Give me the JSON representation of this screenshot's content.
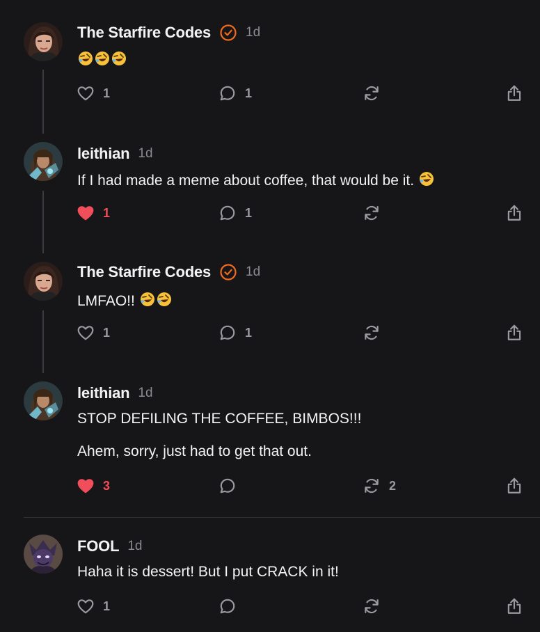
{
  "posts": [
    {
      "author": "The Starfire Codes",
      "verified": true,
      "time": "1d",
      "lines": [
        ""
      ],
      "emoji_count": 3,
      "likes": "1",
      "liked": false,
      "replies": "1",
      "reposts": "",
      "avatar": "starfire"
    },
    {
      "author": "leithian",
      "verified": false,
      "time": "1d",
      "lines": [
        "If I had made a meme about coffee, that would be it."
      ],
      "emoji_count": 1,
      "likes": "1",
      "liked": true,
      "replies": "1",
      "reposts": "",
      "avatar": "leithian"
    },
    {
      "author": "The Starfire Codes",
      "verified": true,
      "time": "1d",
      "lines": [
        "LMFAO!!"
      ],
      "emoji_count": 2,
      "likes": "1",
      "liked": false,
      "replies": "1",
      "reposts": "",
      "avatar": "starfire"
    },
    {
      "author": "leithian",
      "verified": false,
      "time": "1d",
      "lines": [
        "STOP DEFILING THE COFFEE, BIMBOS!!!",
        "Ahem, sorry, just had to get that out."
      ],
      "emoji_count": 0,
      "likes": "3",
      "liked": true,
      "replies": "",
      "reposts": "2",
      "avatar": "leithian"
    },
    {
      "author": "FOOL",
      "verified": false,
      "time": "1d",
      "lines": [
        "Haha it is dessert! But I put CRACK in it!"
      ],
      "emoji_count": 0,
      "likes": "1",
      "liked": false,
      "replies": "",
      "reposts": "",
      "avatar": "fool"
    }
  ],
  "colors": {
    "background": "#161618",
    "accent_orange": "#f26b1d",
    "like_red": "#f04e5a",
    "muted": "#8a8a90"
  },
  "icons": [
    "heart-icon",
    "reply-icon",
    "repost-icon",
    "share-icon",
    "verified-badge-icon",
    "rofl-emoji"
  ]
}
